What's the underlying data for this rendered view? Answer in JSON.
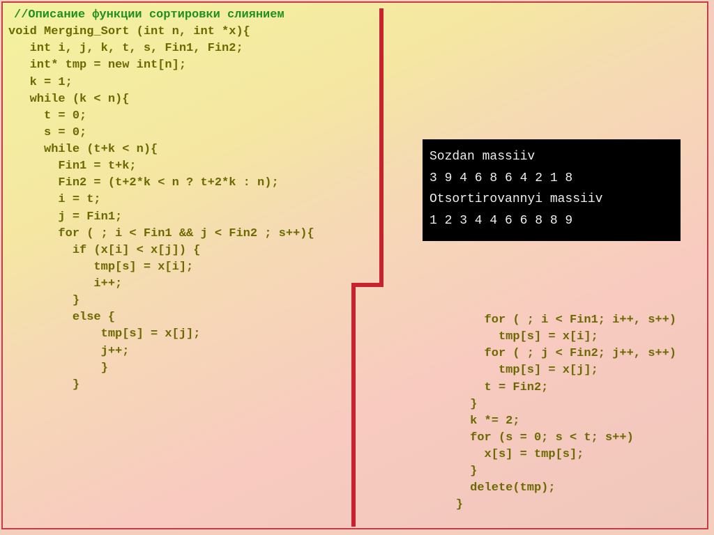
{
  "comment": "//Описание функции сортировки слиянием",
  "code_left": "void Merging_Sort (int n, int *x){\n   int i, j, k, t, s, Fin1, Fin2;\n   int* tmp = new int[n];\n   k = 1;\n   while (k < n){\n     t = 0;\n     s = 0;\n     while (t+k < n){\n       Fin1 = t+k;\n       Fin2 = (t+2*k < n ? t+2*k : n);\n       i = t;\n       j = Fin1;\n       for ( ; i < Fin1 && j < Fin2 ; s++){\n         if (x[i] < x[j]) {\n            tmp[s] = x[i];\n            i++;\n         }\n         else {\n             tmp[s] = x[j];\n             j++;\n             }\n         }",
  "code_right": "     for ( ; i < Fin1; i++, s++)\n       tmp[s] = x[i];\n     for ( ; j < Fin2; j++, s++)\n       tmp[s] = x[j];\n     t = Fin2;\n   }\n   k *= 2;\n   for (s = 0; s < t; s++)\n     x[s] = tmp[s];\n   }\n   delete(tmp);\n }",
  "console": {
    "line1": "Sozdan massiiv",
    "line2": "3 9 4 6 8 6 4 2 1 8",
    "line3": "Otsortirovannyi massiiv",
    "line4": "1 2 3 4 4 6 6 8 8 9"
  }
}
